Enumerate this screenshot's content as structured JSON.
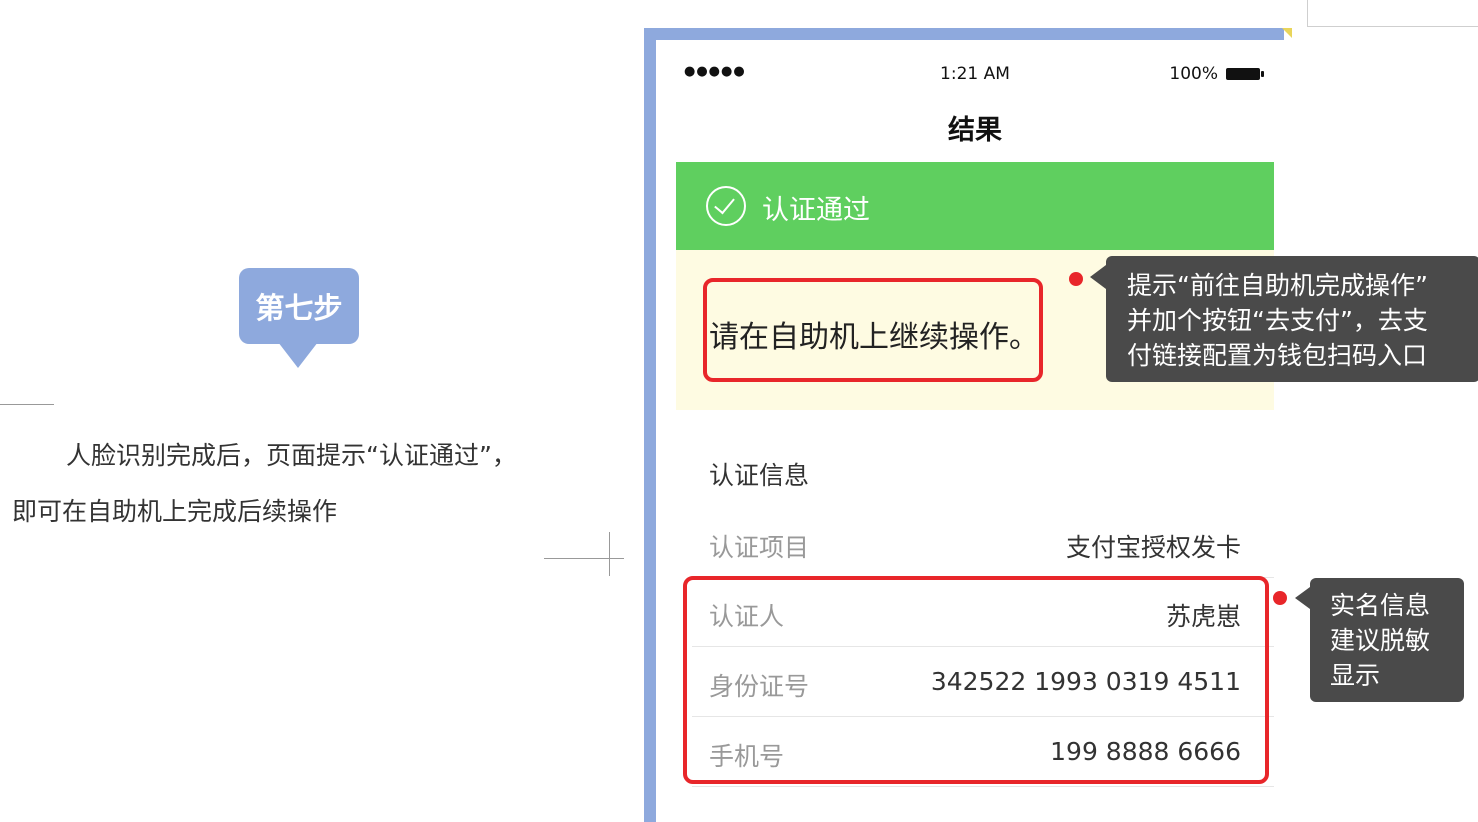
{
  "doc": {
    "step_badge": "第七步",
    "description_line1": "人脸识别完成后，页面提示“认证通过”，",
    "description_line2": "即可在自助机上完成后续操作"
  },
  "phone": {
    "status_bar": {
      "signal": "●●●●●",
      "time": "1:21 AM",
      "battery": "100%"
    },
    "nav_title": "结果",
    "success_banner": {
      "icon": "check-circle-icon",
      "text": "认证通过"
    },
    "notice_text": "请在自助机上继续操作。",
    "section_title": "认证信息",
    "rows": [
      {
        "label": "认证项目",
        "value": "支付宝授权发卡"
      },
      {
        "label": "认证人",
        "value": "苏虎崽"
      },
      {
        "label": "身份证号",
        "value": "342522 1993 0319 4511"
      },
      {
        "label": "手机号",
        "value": "199 8888 6666"
      }
    ]
  },
  "callouts": {
    "notice_comment": {
      "line1": "提示“前往自助机完成操作”",
      "line2": "并加个按钮“去支付”，去支",
      "line3": "付链接配置为钱包扫码入口"
    },
    "info_comment": {
      "line1": "实名信息",
      "line2": "建议脱敏",
      "line3": "显示"
    }
  },
  "colors": {
    "accent_blue": "#8ea9dd",
    "success_green": "#5fcf5f",
    "highlight_red": "#e8262a",
    "notice_bg": "#fefbe2",
    "callout_bg": "#4a4a4a"
  }
}
